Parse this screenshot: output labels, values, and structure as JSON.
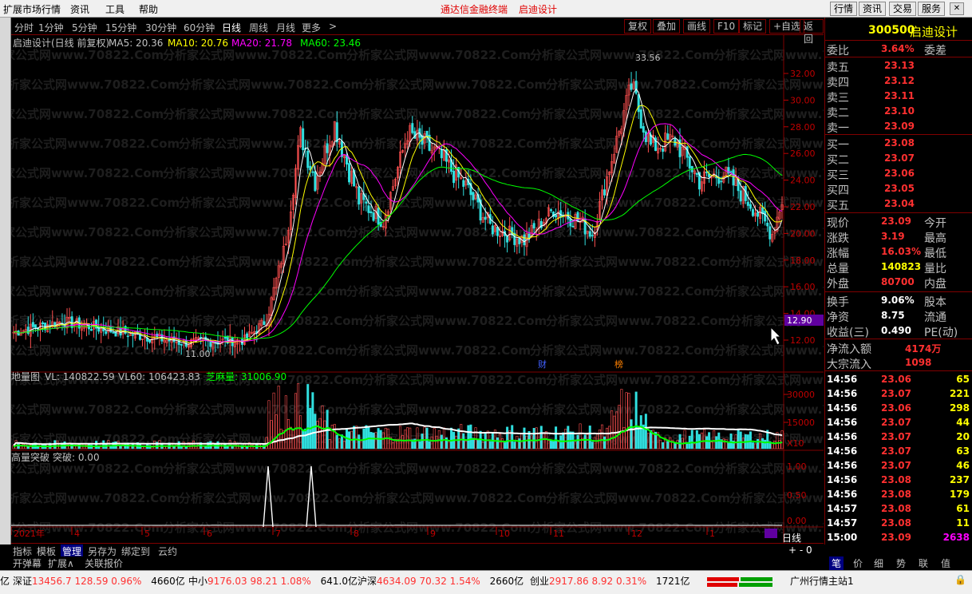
{
  "window": {
    "menus": [
      "扩展市场行情",
      "资讯",
      "工具",
      "帮助"
    ],
    "center_title": "通达信金融终端",
    "center_stock": "启迪设计",
    "right_buttons": [
      "行情",
      "资讯",
      "交易",
      "服务"
    ]
  },
  "periods": {
    "items": [
      "分时",
      "1分钟",
      "5分钟",
      "15分钟",
      "30分钟",
      "60分钟",
      "日线",
      "周线",
      "月线",
      "更多"
    ],
    "selected": "日线",
    "right_buttons": [
      "复权",
      "叠加",
      "画线",
      "F10",
      "标记",
      "+自选",
      "返回"
    ]
  },
  "main_chart": {
    "title": "启迪设计(日线 前复权)",
    "ma5": "MA5: 20.36",
    "ma10": "MA10: 20.76",
    "ma20": "MA20: 21.78",
    "ma60": "MA60: 23.46",
    "price_ticks": [
      "32.00",
      "30.00",
      "28.00",
      "26.00",
      "24.00",
      "22.00",
      "20.00",
      "18.00",
      "16.00",
      "14.00",
      "12.00"
    ],
    "high_label": "33.56",
    "low_label": "11.00",
    "cursor_price": "12.90",
    "markers": [
      "财",
      "榜"
    ],
    "watermark": "分析家公式网www.70822.Com"
  },
  "volume_chart": {
    "title": "地量图",
    "vl": "VL: 140822.59",
    "vl60": "VL60: 106423.83",
    "zmj": "芝麻量: 31006.90",
    "ticks": [
      "30000",
      "15000"
    ],
    "unit": "X10"
  },
  "indicator_chart": {
    "title": "高量突破",
    "value": "突破: 0.00",
    "ticks": [
      "1.00",
      "0.50",
      "0.00"
    ]
  },
  "time_axis": {
    "labels": [
      "2021年",
      "4",
      "5",
      "6",
      "7",
      "8",
      "9",
      "10",
      "11",
      "12",
      "1"
    ]
  },
  "quote": {
    "code": "300500",
    "name": "启迪设计",
    "weibi_label": "委比",
    "weibi": "3.64%",
    "weicha_label": "委差",
    "asks": [
      {
        "label": "卖五",
        "price": "23.13"
      },
      {
        "label": "卖四",
        "price": "23.12"
      },
      {
        "label": "卖三",
        "price": "23.11"
      },
      {
        "label": "卖二",
        "price": "23.10"
      },
      {
        "label": "卖一",
        "price": "23.09"
      }
    ],
    "bids": [
      {
        "label": "买一",
        "price": "23.08"
      },
      {
        "label": "买二",
        "price": "23.07"
      },
      {
        "label": "买三",
        "price": "23.06"
      },
      {
        "label": "买四",
        "price": "23.05"
      },
      {
        "label": "买五",
        "price": "23.04"
      }
    ],
    "stats": [
      {
        "l": "现价",
        "v": "23.09",
        "r": "今开"
      },
      {
        "l": "涨跌",
        "v": "3.19",
        "r": "最高"
      },
      {
        "l": "涨幅",
        "v": "16.03%",
        "r": "最低"
      },
      {
        "l": "总量",
        "v": "140823",
        "r": "量比"
      },
      {
        "l": "外盘",
        "v": "80700",
        "r": "内盘"
      }
    ],
    "stats2": [
      {
        "l": "换手",
        "v": "9.06%",
        "r": "股本"
      },
      {
        "l": "净资",
        "v": "8.75",
        "r": "流通"
      },
      {
        "l": "收益(三)",
        "v": "0.490",
        "r": "PE(动)"
      }
    ],
    "flows": [
      {
        "l": "净流入额",
        "v": "4174万"
      },
      {
        "l": "大宗流入",
        "v": "1098"
      }
    ],
    "ticks": [
      {
        "t": "14:56",
        "p": "23.06",
        "v": "65"
      },
      {
        "t": "14:56",
        "p": "23.07",
        "v": "221"
      },
      {
        "t": "14:56",
        "p": "23.06",
        "v": "298"
      },
      {
        "t": "14:56",
        "p": "23.07",
        "v": "44"
      },
      {
        "t": "14:56",
        "p": "23.07",
        "v": "20"
      },
      {
        "t": "14:56",
        "p": "23.07",
        "v": "63"
      },
      {
        "t": "14:56",
        "p": "23.07",
        "v": "46"
      },
      {
        "t": "14:56",
        "p": "23.08",
        "v": "237"
      },
      {
        "t": "14:56",
        "p": "23.08",
        "v": "179"
      },
      {
        "t": "14:57",
        "p": "23.08",
        "v": "61"
      },
      {
        "t": "14:57",
        "p": "23.08",
        "v": "11"
      },
      {
        "t": "15:00",
        "p": "23.09",
        "v": "2638"
      }
    ]
  },
  "tabs": {
    "row1": [
      "指标",
      "模板",
      "管理",
      "另存为",
      "绑定到",
      "云约"
    ],
    "selected": "管理",
    "row2": [
      "开弹幕",
      "扩展∧",
      "关联报价"
    ],
    "right": [
      "笔",
      "价",
      "细",
      "势",
      "联",
      "值"
    ],
    "period_label": "日线"
  },
  "status": {
    "items": [
      {
        "name": "深证",
        "idx": "13456.7",
        "chg": "128.59",
        "pct": "0.96%",
        "amt": "4660亿"
      },
      {
        "name": "中小",
        "idx": "9176.03",
        "chg": "98.21",
        "pct": "1.08%",
        "amt": "641.0亿"
      },
      {
        "name": "沪深",
        "idx": "4634.09",
        "chg": "70.32",
        "pct": "1.54%",
        "amt": "2660亿"
      },
      {
        "name": "创业",
        "idx": "2917.86",
        "chg": "8.92",
        "pct": "0.31%",
        "amt": "1721亿"
      }
    ],
    "prefix": "亿",
    "server": "广州行情主站1"
  }
}
